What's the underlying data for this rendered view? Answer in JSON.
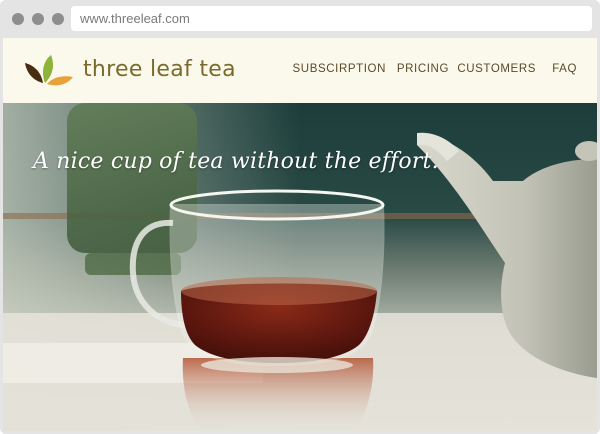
{
  "browser": {
    "url": "www.threeleaf.com"
  },
  "site": {
    "logo_text": "three leaf tea",
    "nav": [
      {
        "label": "SUBSCIRPTION"
      },
      {
        "label": "PRICING"
      },
      {
        "label": "CUSTOMERS"
      },
      {
        "label": "FAQ"
      }
    ]
  },
  "hero": {
    "tagline": "A nice cup of tea without the effort."
  },
  "icons": {
    "logo": "three-leaves-icon"
  },
  "colors": {
    "header_bg": "#fbf9ec",
    "logo_text": "#7a6a2c",
    "nav_text": "#5a4a2a",
    "leaf_green": "#8db33a",
    "leaf_orange": "#e8a23a",
    "leaf_brown": "#5a3a1a"
  }
}
